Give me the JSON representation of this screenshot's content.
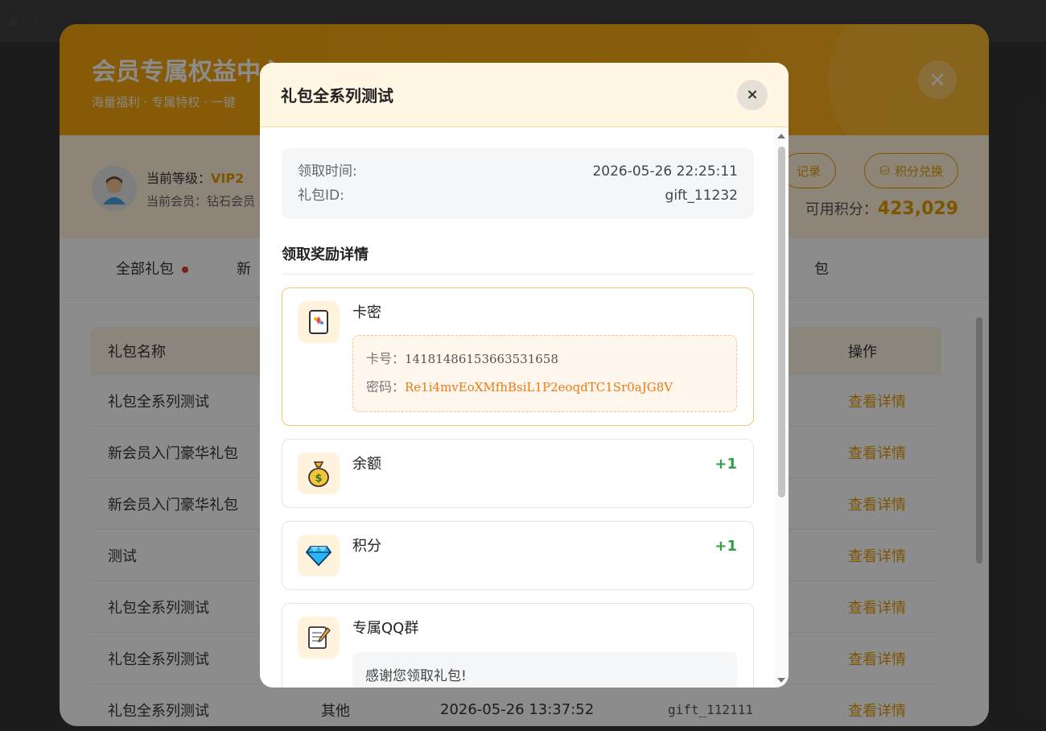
{
  "outer": {
    "title": "会员专属权益中心",
    "subtitle": "海量福利 · 专属特权 · 一键",
    "close": "×",
    "level_label": "当前等级：",
    "level_value": "VIP2",
    "member_label": "当前会员：钻石会员",
    "records_button": "记录",
    "exchange_button": "积分兑换",
    "points_label": "可用积分：",
    "points_value": "423,029",
    "tabs": [
      "全部礼包",
      "新",
      "包"
    ],
    "table": {
      "headers": [
        "礼包名称",
        "",
        "",
        "",
        "操作"
      ],
      "rows": [
        [
          "礼包全系列测试",
          "",
          "",
          "",
          "查看详情"
        ],
        [
          "新会员入门豪华礼包",
          "",
          "",
          "",
          "查看详情"
        ],
        [
          "新会员入门豪华礼包",
          "",
          "",
          "",
          "查看详情"
        ],
        [
          "测试",
          "",
          "",
          "",
          "查看详情"
        ],
        [
          "礼包全系列测试",
          "",
          "",
          "",
          "查看详情"
        ],
        [
          "礼包全系列测试",
          "",
          "",
          "",
          "查看详情"
        ],
        [
          "礼包全系列测试",
          "其他",
          "2026-05-26 13:37:52",
          "gift_112111",
          "查看详情"
        ]
      ]
    }
  },
  "dialog": {
    "title": "礼包全系列测试",
    "close": "×",
    "claim_time_label": "领取时间:",
    "claim_time": "2026-05-26 22:25:11",
    "gift_id_label": "礼包ID:",
    "gift_id": "gift_11232",
    "section_title": "领取奖励详情",
    "rewards": {
      "card": {
        "name": "卡密",
        "card_no_label": "卡号：",
        "card_no": "14181486153663531658",
        "password_label": "密码：",
        "password": "Re1i4mvEoXMfhBsiL1P2eoqdTC1Sr0aJG8V"
      },
      "balance": {
        "name": "余额",
        "value": "+1"
      },
      "points": {
        "name": "积分",
        "value": "+1"
      },
      "qq": {
        "name": "专属QQ群",
        "message": "感谢您领取礼包!"
      }
    }
  },
  "colors": {
    "accent": "#e39c00",
    "orange_text": "#ee7a13",
    "plus_green": "#2ea043"
  }
}
